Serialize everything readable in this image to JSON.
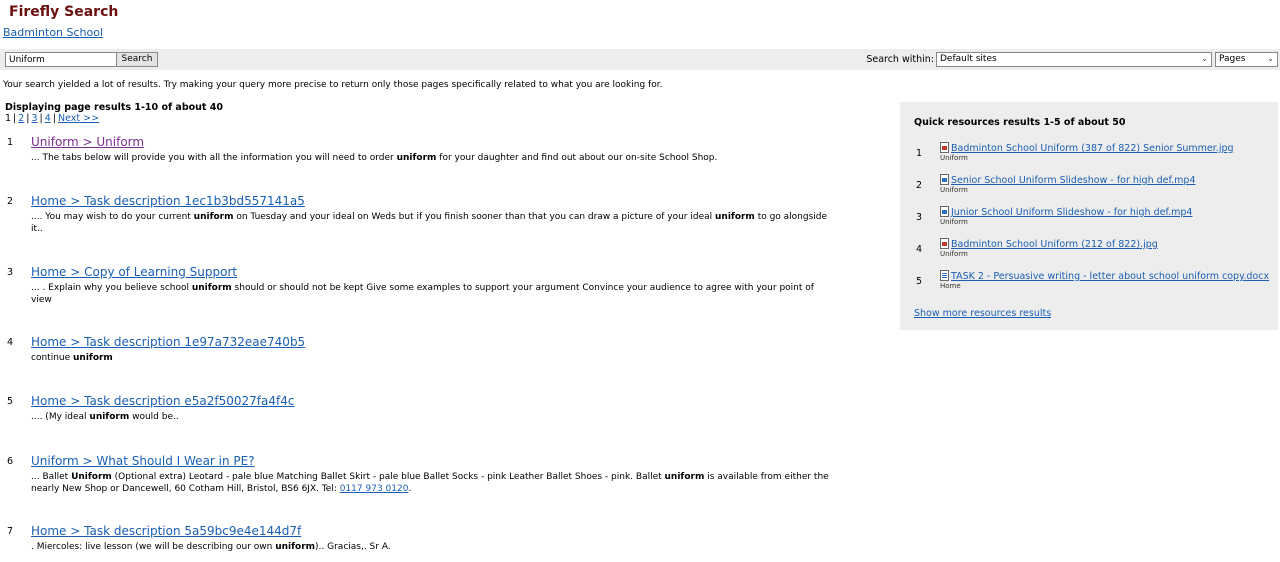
{
  "header": {
    "brand": "Firefly Search",
    "school": "Badminton School"
  },
  "search": {
    "query": "Uniform",
    "button_label": "Search",
    "within_label": "Search within:",
    "sites_value": "Default sites",
    "scope_value": "Pages"
  },
  "advice": "Your search yielded a lot of results. Try making your query more precise to return only those pages specifically related to what you are looking for.",
  "results_header": {
    "displaying": "Displaying page results 1-10 of about 40",
    "pages": [
      "1",
      "2",
      "3",
      "4"
    ],
    "next": "Next >>"
  },
  "results": [
    {
      "num": "1",
      "title": "Uniform  >  Uniform",
      "visited": true,
      "snippet": [
        {
          "t": "...  The tabs below will provide you with all the information you will need to order "
        },
        {
          "b": "uniform"
        },
        {
          "t": " for your daughter and find out about our on-site School Shop."
        }
      ]
    },
    {
      "num": "2",
      "title": "Home  >  Task description 1ec1b3bd557141a5",
      "snippet": [
        {
          "t": ".... You may wish to do your current "
        },
        {
          "b": "uniform"
        },
        {
          "t": " on Tuesday and your ideal on Weds but if you finish sooner than that you can draw a picture of your ideal "
        },
        {
          "b": "uniform"
        },
        {
          "t": " to go alongside it.."
        }
      ]
    },
    {
      "num": "3",
      "title": "Home  >  Copy of Learning Support",
      "snippet": [
        {
          "t": "... . Explain why you believe school "
        },
        {
          "b": "uniform"
        },
        {
          "t": " should or should not be kept Give some examples to support your argument Convince your audience to agree with your point of view"
        }
      ]
    },
    {
      "num": "4",
      "title": "Home  >  Task description 1e97a732eae740b5",
      "snippet": [
        {
          "t": "continue "
        },
        {
          "b": "uniform"
        }
      ]
    },
    {
      "num": "5",
      "title": "Home  >  Task description e5a2f50027fa4f4c",
      "snippet": [
        {
          "t": ".... (My ideal "
        },
        {
          "b": "uniform"
        },
        {
          "t": " would be.."
        }
      ]
    },
    {
      "num": "6",
      "title": "Uniform  >  What Should I Wear in PE?",
      "snippet": [
        {
          "t": "... Ballet "
        },
        {
          "b": "Uniform"
        },
        {
          "t": " (Optional extra) Leotard - pale blue Matching Ballet Skirt - pale blue Ballet Socks - pink Leather Ballet Shoes - pink. Ballet "
        },
        {
          "b": "uniform"
        },
        {
          "t": " is available from either the nearly New Shop or Dancewell, 60 Cotham Hill, Bristol, BS6 6JX. Tel: "
        },
        {
          "a": "0117 973 0120"
        },
        {
          "t": "."
        }
      ]
    },
    {
      "num": "7",
      "title": "Home  >  Task description 5a59bc9e4e144d7f",
      "snippet": [
        {
          "t": ". Miercoles: live lesson (we will be describing our own "
        },
        {
          "b": "uniform"
        },
        {
          "t": ").. Gracias,. Sr A."
        }
      ]
    }
  ],
  "quick": {
    "header": "Quick resources results 1-5 of about 50",
    "items": [
      {
        "num": "1",
        "icon": "image-file-icon",
        "kind": "img",
        "label": "Badminton School Uniform (387 of 822) Senior Summer.jpg",
        "sub": "Uniform"
      },
      {
        "num": "2",
        "icon": "video-file-icon",
        "kind": "vid",
        "label": "Senior School Uniform Slideshow - for high def.mp4",
        "sub": "Uniform"
      },
      {
        "num": "3",
        "icon": "video-file-icon",
        "kind": "vid",
        "label": "Junior School Uniform Slideshow - for high def.mp4",
        "sub": "Uniform"
      },
      {
        "num": "4",
        "icon": "image-file-icon",
        "kind": "img",
        "label": "Badminton School Uniform (212 of 822).jpg",
        "sub": "Uniform"
      },
      {
        "num": "5",
        "icon": "word-document-icon",
        "kind": "doc",
        "label": "TASK 2 - Persuasive writing - letter about school uniform copy.docx",
        "sub": "Home"
      }
    ],
    "more": "Show more resources results"
  }
}
